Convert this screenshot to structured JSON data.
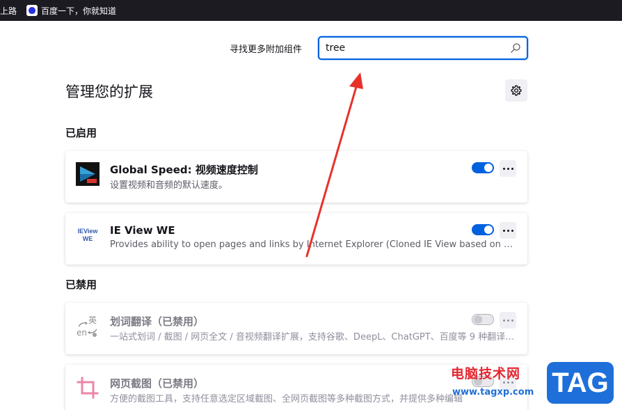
{
  "bookmarks": {
    "cut_item": "上路",
    "baidu_label": "百度一下，你就知道"
  },
  "search": {
    "label": "寻找更多附加组件",
    "value": "tree"
  },
  "page": {
    "title": "管理您的扩展"
  },
  "sections": {
    "enabled_heading": "已启用",
    "disabled_heading": "已禁用"
  },
  "extensions": [
    {
      "name": "Global Speed: 视频速度控制",
      "description": "设置视频和音频的默认速度。",
      "enabled": true,
      "icon": "global-speed-icon"
    },
    {
      "name": "IE View WE",
      "description": "Provides ability to open pages and links by Internet Explorer (Cloned IE View based on WebExtensions)",
      "enabled": true,
      "icon": "ie-view-icon",
      "icon_text_1": "IEView",
      "icon_text_2": "WE"
    },
    {
      "name": "划词翻译（已禁用）",
      "description": "一站式划词 / 截图 / 网页全文 / 音视频翻译扩展，支持谷歌、DeepL、ChatGPT、百度等 9 种翻译服务",
      "enabled": false,
      "icon": "translate-icon",
      "icon_text_1": "英",
      "icon_text_2": "en"
    },
    {
      "name": "网页截图（已禁用）",
      "description": "方便的截图工具，支持任意选定区域截图、全网页截图等多种截图方式，并提供多种编辑",
      "enabled": false,
      "icon": "crop-icon"
    }
  ],
  "watermark": {
    "title": "电脑技术网",
    "url": "www.tagxp.com",
    "badge": "TAG"
  },
  "colors": {
    "accent": "#0061e0",
    "arrow": "#e8302a",
    "bookmarks_bg": "#1c1b22"
  }
}
